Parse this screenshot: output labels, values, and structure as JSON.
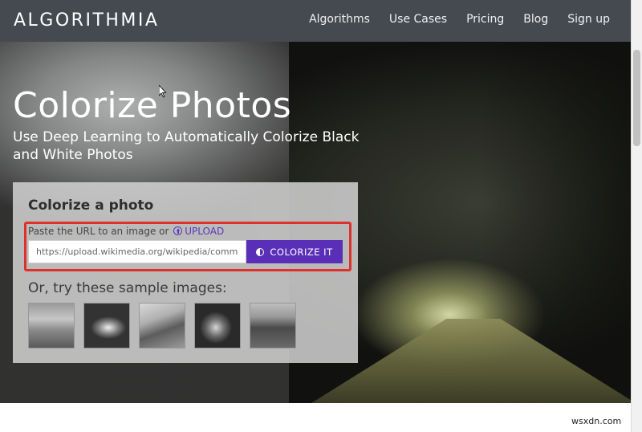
{
  "header": {
    "logo": "ALGORITHMIA",
    "nav": [
      "Algorithms",
      "Use Cases",
      "Pricing",
      "Blog",
      "Sign up"
    ]
  },
  "hero": {
    "title": "Colorize Photos",
    "subtitle": "Use Deep Learning to Automatically Colorize Black and White Photos"
  },
  "card": {
    "title": "Colorize a photo",
    "url_label": "Paste the URL to an image or",
    "upload_label": "UPLOAD",
    "url_value": "https://upload.wikimedia.org/wikipedia/commons/",
    "button_label": "COLORIZE IT",
    "samples_label": "Or, try these sample images:",
    "samples": [
      "sample-image-1",
      "sample-image-2",
      "sample-image-3",
      "sample-image-4",
      "sample-image-5"
    ]
  },
  "watermark": "wsxdn.com",
  "colors": {
    "nav_bg": "#454a51",
    "accent": "#5a2fb8",
    "highlight": "#e0302c"
  },
  "icons": {
    "upload": "upload-circle-icon",
    "colorize": "half-circle-icon",
    "cursor": "mouse-pointer-icon"
  }
}
